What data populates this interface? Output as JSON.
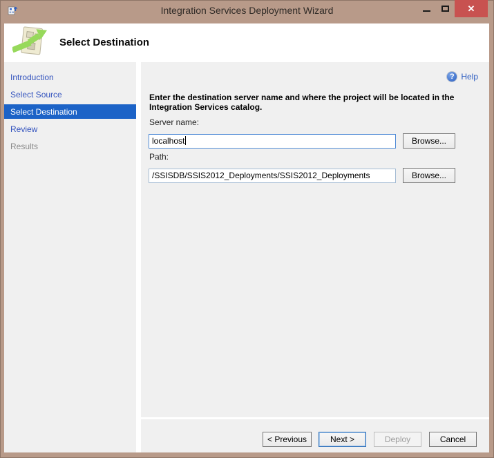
{
  "window": {
    "title": "Integration Services Deployment Wizard",
    "close_glyph": "✕"
  },
  "header": {
    "title": "Select Destination"
  },
  "sidebar": {
    "items": [
      {
        "label": "Introduction",
        "state": "link"
      },
      {
        "label": "Select Source",
        "state": "link"
      },
      {
        "label": "Select Destination",
        "state": "selected"
      },
      {
        "label": "Review",
        "state": "link"
      },
      {
        "label": "Results",
        "state": "disabled"
      }
    ]
  },
  "content": {
    "help": {
      "label": "Help",
      "icon_glyph": "?"
    },
    "instruction": "Enter the destination server name and where the project will be located in the Integration Services catalog.",
    "server": {
      "label": "Server name:",
      "value": "localhost",
      "browse_label": "Browse..."
    },
    "path": {
      "label": "Path:",
      "value": "/SSISDB/SSIS2012_Deployments/SSIS2012_Deployments",
      "browse_label": "Browse..."
    }
  },
  "footer": {
    "previous_label": "< Previous",
    "next_label": "Next >",
    "deploy_label": "Deploy",
    "cancel_label": "Cancel"
  },
  "colors": {
    "titlebar": "#B89A89",
    "close_button": "#C85250",
    "selected_nav": "#1C63C7",
    "link_blue": "#3353BE",
    "panel_gray": "#F0F0F0",
    "focused_input_border": "#4F8AD6"
  }
}
